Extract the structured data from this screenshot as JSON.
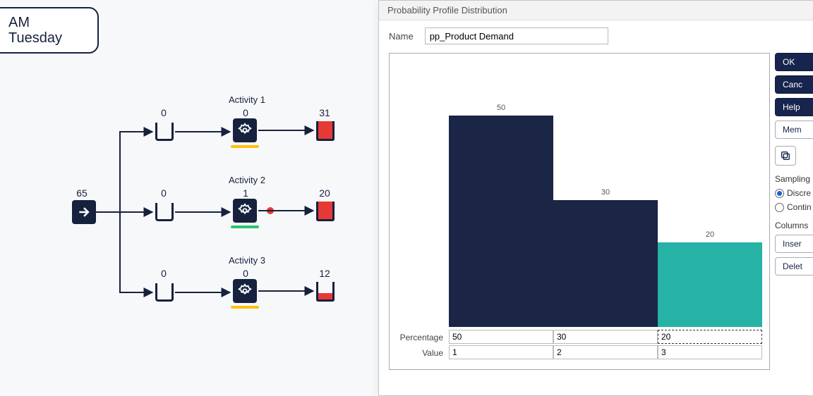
{
  "clock": {
    "line1": "AM",
    "line2": "Tuesday"
  },
  "diagram": {
    "entry_count": "65",
    "rows": [
      {
        "name": "Activity 1",
        "queue_count": "0",
        "in_act": "0",
        "sink_count": "31",
        "underline": "yellow",
        "fill_pct": 100
      },
      {
        "name": "Activity 2",
        "queue_count": "0",
        "in_act": "1",
        "sink_count": "20",
        "underline": "green",
        "fill_pct": 100
      },
      {
        "name": "Activity 3",
        "queue_count": "0",
        "in_act": "0",
        "sink_count": "12",
        "underline": "yellow",
        "fill_pct": 35
      }
    ]
  },
  "dialog": {
    "title": "Probability Profile Distribution",
    "name_label": "Name",
    "name_value": "pp_Product Demand",
    "buttons": {
      "ok": "OK",
      "cancel": "Canc",
      "help": "Help",
      "memo": "Mem"
    },
    "icon_copy": "copy-icon",
    "sampling": {
      "label": "Sampling",
      "discrete": "Discre",
      "continuous": "Contin",
      "selected": "discrete"
    },
    "columns": {
      "label": "Columns",
      "insert": "Inser",
      "delete": "Delet"
    },
    "row_labels": {
      "percentage": "Percentage",
      "value": "Value"
    }
  },
  "chart_data": {
    "type": "bar",
    "categories": [
      "1",
      "2",
      "3"
    ],
    "values": [
      50,
      30,
      20
    ],
    "series_colors": [
      "#1b2545",
      "#1b2545",
      "#26b3a5"
    ],
    "title": "",
    "xlabel": "Value",
    "ylabel": "Percentage",
    "ylim": [
      0,
      50
    ]
  }
}
